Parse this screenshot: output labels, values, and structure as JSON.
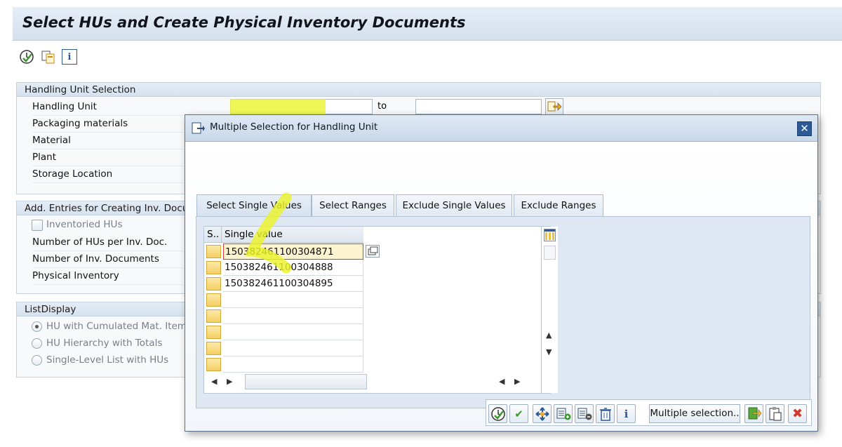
{
  "window": {
    "title": "Select HUs and Create Physical Inventory Documents"
  },
  "toolbar": {
    "icons": [
      "execute-icon",
      "get-variant-icon",
      "info-icon"
    ]
  },
  "handling_unit_selection": {
    "header": "Handling Unit Selection",
    "rows": [
      "Handling Unit",
      "Packaging materials",
      "Material",
      "Plant",
      "Storage Location"
    ],
    "to_label": "to"
  },
  "add_entries": {
    "header": "Add. Entries for Creating Inv. Docum",
    "checkbox_label": "Inventoried HUs",
    "rows": [
      "Number of HUs per Inv. Doc.",
      "Number of Inv. Documents",
      "Physical Inventory"
    ]
  },
  "list_display": {
    "header": "ListDisplay",
    "options": [
      "HU with Cumulated Mat. Items",
      "HU Hierarchy with Totals",
      "Single-Level List with HUs"
    ],
    "selected_index": 0
  },
  "dialog": {
    "title": "Multiple Selection for Handling Unit",
    "close_symbol": "✕",
    "tabs": [
      "Select Single Values",
      "Select Ranges",
      "Exclude Single Values",
      "Exclude Ranges"
    ],
    "active_tab": 0,
    "grid": {
      "col_sel": "S..",
      "col_value": "Single value",
      "values": [
        "150382461100304871",
        "150382461100304888",
        "150382461100304895"
      ],
      "empty_rows": 4
    },
    "buttons": {
      "multiple_selection": "Multiple selection.."
    }
  },
  "colors": {
    "highlight": "#ecf328",
    "close_bg": "#2d5a96",
    "selector_yellow": "#f4cf63"
  }
}
